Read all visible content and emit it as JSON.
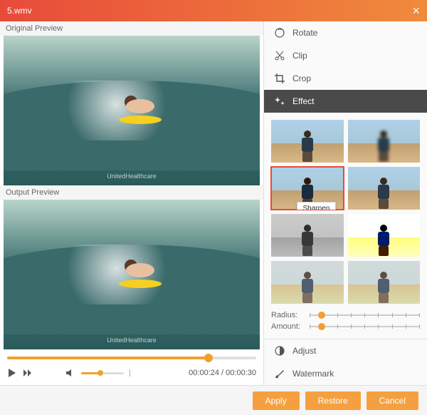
{
  "title": "5.wmv",
  "labels": {
    "original": "Original Preview",
    "output": "Output Preview",
    "watermark_text": "UnitedHealthcare"
  },
  "playback": {
    "current": "00:00:24",
    "total": "00:00:30",
    "progress_pct": 80,
    "volume_pct": 40
  },
  "tabs": {
    "rotate": "Rotate",
    "clip": "Clip",
    "crop": "Crop",
    "effect": "Effect",
    "adjust": "Adjust",
    "watermark": "Watermark"
  },
  "effects": {
    "tooltip": "Sharpen",
    "sliders": {
      "radius_label": "Radius:",
      "amount_label": "Amount:",
      "radius_pct": 8,
      "amount_pct": 8
    }
  },
  "buttons": {
    "apply": "Apply",
    "restore": "Restore",
    "cancel": "Cancel"
  }
}
